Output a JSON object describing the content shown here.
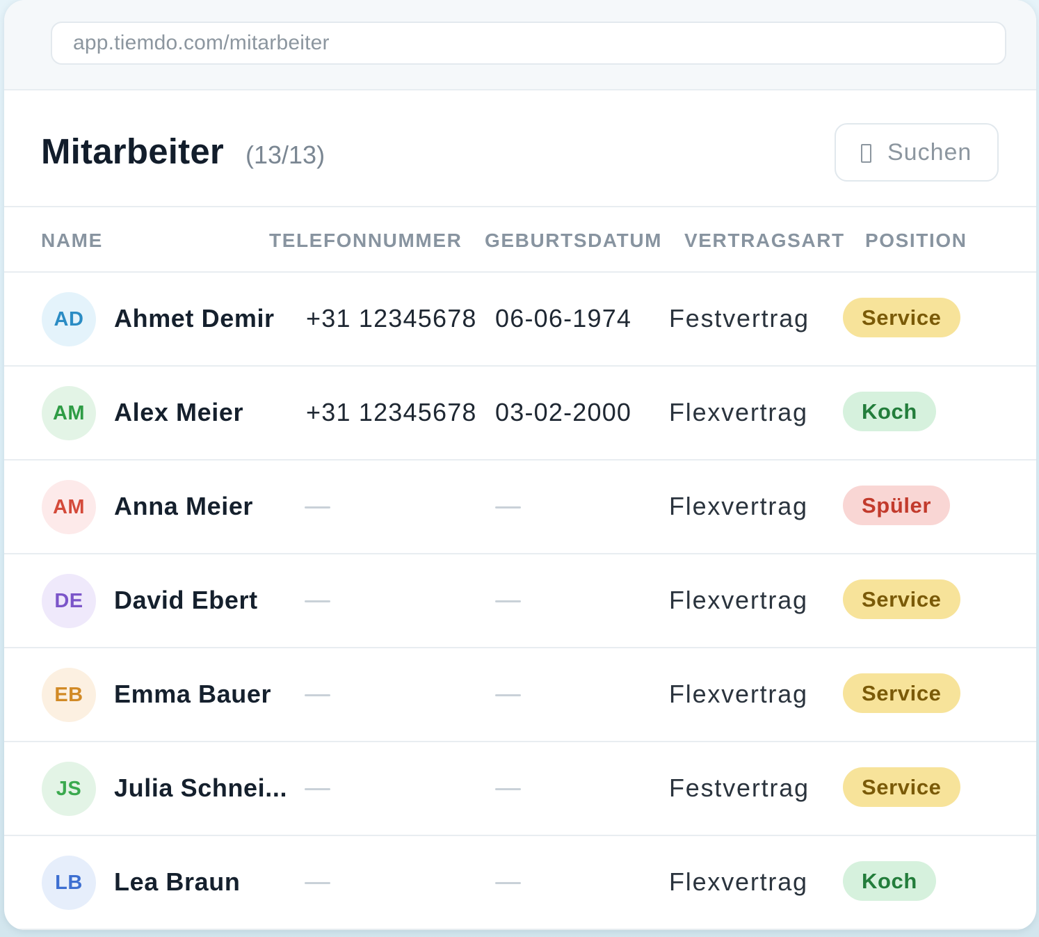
{
  "browser": {
    "url": "app.tiemdo.com/mitarbeiter"
  },
  "header": {
    "title": "Mitarbeiter",
    "count": "(13/13)",
    "search_label": "Suchen",
    "search_icon": "search-icon"
  },
  "table": {
    "columns": {
      "name": "NAME",
      "phone": "TELEFONNUMMER",
      "birthdate": "GEBURTSDATUM",
      "contract": "VERTRAGSART",
      "position": "POSITION"
    },
    "rows": [
      {
        "initials": "AD",
        "name": "Ahmet Demir",
        "phone": "+31 12345678",
        "birthdate": "06-06-1974",
        "contract": "Festvertrag",
        "position": "Service",
        "avatar_bg": "#e4f3fb",
        "avatar_fg": "#2b8cc4",
        "badge_bg": "#f7e39a",
        "badge_fg": "#7a5a08"
      },
      {
        "initials": "AM",
        "name": "Alex Meier",
        "phone": "+31 12345678",
        "birthdate": "03-02-2000",
        "contract": "Flexvertrag",
        "position": "Koch",
        "avatar_bg": "#e3f4e6",
        "avatar_fg": "#2e9c45",
        "badge_bg": "#d6f1dd",
        "badge_fg": "#237d3b"
      },
      {
        "initials": "AM",
        "name": "Anna Meier",
        "phone": "",
        "birthdate": "",
        "contract": "Flexvertrag",
        "position": "Spüler",
        "avatar_bg": "#fdeaea",
        "avatar_fg": "#d44a3a",
        "badge_bg": "#f9d6d4",
        "badge_fg": "#c23a2c"
      },
      {
        "initials": "DE",
        "name": "David Ebert",
        "phone": "",
        "birthdate": "",
        "contract": "Flexvertrag",
        "position": "Service",
        "avatar_bg": "#efe9fb",
        "avatar_fg": "#7b55c9",
        "badge_bg": "#f7e39a",
        "badge_fg": "#7a5a08"
      },
      {
        "initials": "EB",
        "name": "Emma Bauer",
        "phone": "",
        "birthdate": "",
        "contract": "Flexvertrag",
        "position": "Service",
        "avatar_bg": "#fcf0e1",
        "avatar_fg": "#d18a26",
        "badge_bg": "#f7e39a",
        "badge_fg": "#7a5a08"
      },
      {
        "initials": "JS",
        "name": "Julia Schnei...",
        "phone": "",
        "birthdate": "",
        "contract": "Festvertrag",
        "position": "Service",
        "avatar_bg": "#e3f4e6",
        "avatar_fg": "#3aa94e",
        "badge_bg": "#f7e39a",
        "badge_fg": "#7a5a08"
      },
      {
        "initials": "LB",
        "name": "Lea Braun",
        "phone": "",
        "birthdate": "",
        "contract": "Flexvertrag",
        "position": "Koch",
        "avatar_bg": "#e6eefb",
        "avatar_fg": "#3d6fd1",
        "badge_bg": "#d6f1dd",
        "badge_fg": "#237d3b"
      }
    ]
  }
}
